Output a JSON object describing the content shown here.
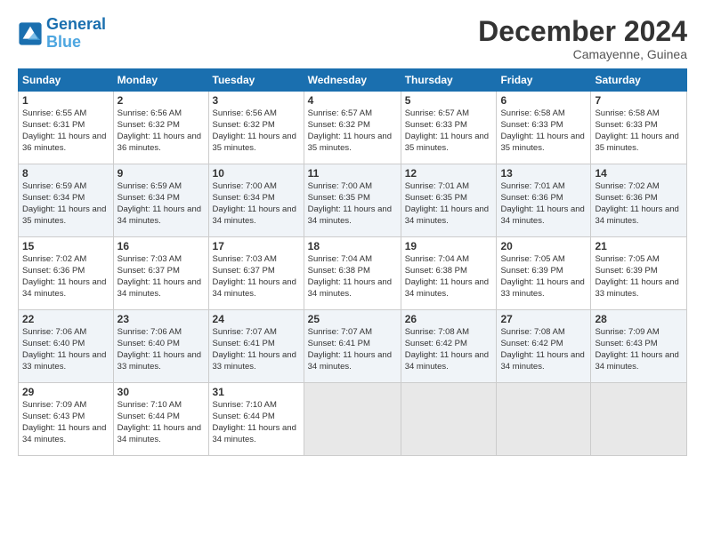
{
  "header": {
    "logo_line1": "General",
    "logo_line2": "Blue",
    "month_title": "December 2024",
    "location": "Camayenne, Guinea"
  },
  "calendar": {
    "days_of_week": [
      "Sunday",
      "Monday",
      "Tuesday",
      "Wednesday",
      "Thursday",
      "Friday",
      "Saturday"
    ],
    "weeks": [
      [
        {
          "day": "",
          "empty": true
        },
        {
          "day": "",
          "empty": true
        },
        {
          "day": "",
          "empty": true
        },
        {
          "day": "",
          "empty": true
        },
        {
          "day": "",
          "empty": true
        },
        {
          "day": "",
          "empty": true
        },
        {
          "day": "",
          "empty": true
        }
      ],
      [
        {
          "day": "1",
          "sunrise": "6:55 AM",
          "sunset": "6:31 PM",
          "daylight": "11 hours and 36 minutes."
        },
        {
          "day": "2",
          "sunrise": "6:56 AM",
          "sunset": "6:32 PM",
          "daylight": "11 hours and 36 minutes."
        },
        {
          "day": "3",
          "sunrise": "6:56 AM",
          "sunset": "6:32 PM",
          "daylight": "11 hours and 35 minutes."
        },
        {
          "day": "4",
          "sunrise": "6:57 AM",
          "sunset": "6:32 PM",
          "daylight": "11 hours and 35 minutes."
        },
        {
          "day": "5",
          "sunrise": "6:57 AM",
          "sunset": "6:33 PM",
          "daylight": "11 hours and 35 minutes."
        },
        {
          "day": "6",
          "sunrise": "6:58 AM",
          "sunset": "6:33 PM",
          "daylight": "11 hours and 35 minutes."
        },
        {
          "day": "7",
          "sunrise": "6:58 AM",
          "sunset": "6:33 PM",
          "daylight": "11 hours and 35 minutes."
        }
      ],
      [
        {
          "day": "8",
          "sunrise": "6:59 AM",
          "sunset": "6:34 PM",
          "daylight": "11 hours and 35 minutes."
        },
        {
          "day": "9",
          "sunrise": "6:59 AM",
          "sunset": "6:34 PM",
          "daylight": "11 hours and 34 minutes."
        },
        {
          "day": "10",
          "sunrise": "7:00 AM",
          "sunset": "6:34 PM",
          "daylight": "11 hours and 34 minutes."
        },
        {
          "day": "11",
          "sunrise": "7:00 AM",
          "sunset": "6:35 PM",
          "daylight": "11 hours and 34 minutes."
        },
        {
          "day": "12",
          "sunrise": "7:01 AM",
          "sunset": "6:35 PM",
          "daylight": "11 hours and 34 minutes."
        },
        {
          "day": "13",
          "sunrise": "7:01 AM",
          "sunset": "6:36 PM",
          "daylight": "11 hours and 34 minutes."
        },
        {
          "day": "14",
          "sunrise": "7:02 AM",
          "sunset": "6:36 PM",
          "daylight": "11 hours and 34 minutes."
        }
      ],
      [
        {
          "day": "15",
          "sunrise": "7:02 AM",
          "sunset": "6:36 PM",
          "daylight": "11 hours and 34 minutes."
        },
        {
          "day": "16",
          "sunrise": "7:03 AM",
          "sunset": "6:37 PM",
          "daylight": "11 hours and 34 minutes."
        },
        {
          "day": "17",
          "sunrise": "7:03 AM",
          "sunset": "6:37 PM",
          "daylight": "11 hours and 34 minutes."
        },
        {
          "day": "18",
          "sunrise": "7:04 AM",
          "sunset": "6:38 PM",
          "daylight": "11 hours and 34 minutes."
        },
        {
          "day": "19",
          "sunrise": "7:04 AM",
          "sunset": "6:38 PM",
          "daylight": "11 hours and 34 minutes."
        },
        {
          "day": "20",
          "sunrise": "7:05 AM",
          "sunset": "6:39 PM",
          "daylight": "11 hours and 33 minutes."
        },
        {
          "day": "21",
          "sunrise": "7:05 AM",
          "sunset": "6:39 PM",
          "daylight": "11 hours and 33 minutes."
        }
      ],
      [
        {
          "day": "22",
          "sunrise": "7:06 AM",
          "sunset": "6:40 PM",
          "daylight": "11 hours and 33 minutes."
        },
        {
          "day": "23",
          "sunrise": "7:06 AM",
          "sunset": "6:40 PM",
          "daylight": "11 hours and 33 minutes."
        },
        {
          "day": "24",
          "sunrise": "7:07 AM",
          "sunset": "6:41 PM",
          "daylight": "11 hours and 33 minutes."
        },
        {
          "day": "25",
          "sunrise": "7:07 AM",
          "sunset": "6:41 PM",
          "daylight": "11 hours and 34 minutes."
        },
        {
          "day": "26",
          "sunrise": "7:08 AM",
          "sunset": "6:42 PM",
          "daylight": "11 hours and 34 minutes."
        },
        {
          "day": "27",
          "sunrise": "7:08 AM",
          "sunset": "6:42 PM",
          "daylight": "11 hours and 34 minutes."
        },
        {
          "day": "28",
          "sunrise": "7:09 AM",
          "sunset": "6:43 PM",
          "daylight": "11 hours and 34 minutes."
        }
      ],
      [
        {
          "day": "29",
          "sunrise": "7:09 AM",
          "sunset": "6:43 PM",
          "daylight": "11 hours and 34 minutes."
        },
        {
          "day": "30",
          "sunrise": "7:10 AM",
          "sunset": "6:44 PM",
          "daylight": "11 hours and 34 minutes."
        },
        {
          "day": "31",
          "sunrise": "7:10 AM",
          "sunset": "6:44 PM",
          "daylight": "11 hours and 34 minutes."
        },
        {
          "day": "",
          "empty": true
        },
        {
          "day": "",
          "empty": true
        },
        {
          "day": "",
          "empty": true
        },
        {
          "day": "",
          "empty": true
        }
      ]
    ]
  }
}
